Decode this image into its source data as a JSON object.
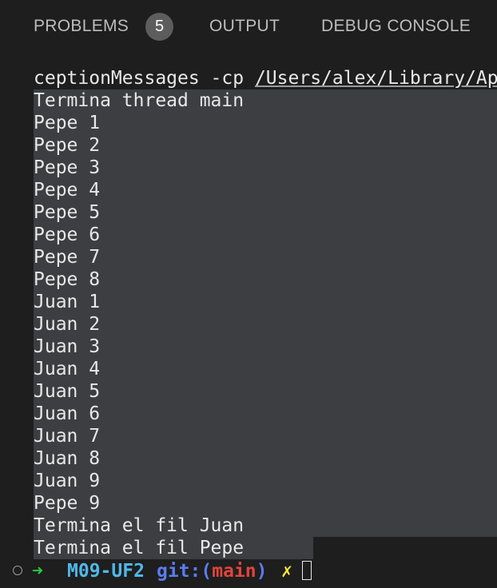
{
  "tabs": {
    "problems_label": "PROBLEMS",
    "problems_count": "5",
    "output_label": "OUTPUT",
    "debug_label": "DEBUG CONSOLE"
  },
  "terminal": {
    "command_prefix": "ceptionMessages -cp ",
    "command_path": "/Users/alex/Library/Ap",
    "output_lines": [
      "Termina thread main",
      "Pepe 1",
      "Pepe 2",
      "Pepe 3",
      "Pepe 4",
      "Pepe 5",
      "Pepe 6",
      "Pepe 7",
      "Pepe 8",
      "Juan 1",
      "Juan 2",
      "Juan 3",
      "Juan 4",
      "Juan 5",
      "Juan 6",
      "Juan 7",
      "Juan 8",
      "Juan 9",
      "Pepe 9",
      "Termina el fil Juan",
      "Termina el fil Pepe"
    ],
    "prompt": {
      "arrow": "➜",
      "directory": "M09-UF2",
      "git_label": "git:(",
      "branch": "main",
      "git_close": ")",
      "dirty_mark": "✗"
    }
  },
  "colors": {
    "background": "#1e1e1e",
    "selection": "#3d3e42",
    "arrow": "#27c93f",
    "directory": "#4fb8e8",
    "git": "#5a7cf0",
    "branch": "#e0443b",
    "dirty": "#ffe83a"
  }
}
